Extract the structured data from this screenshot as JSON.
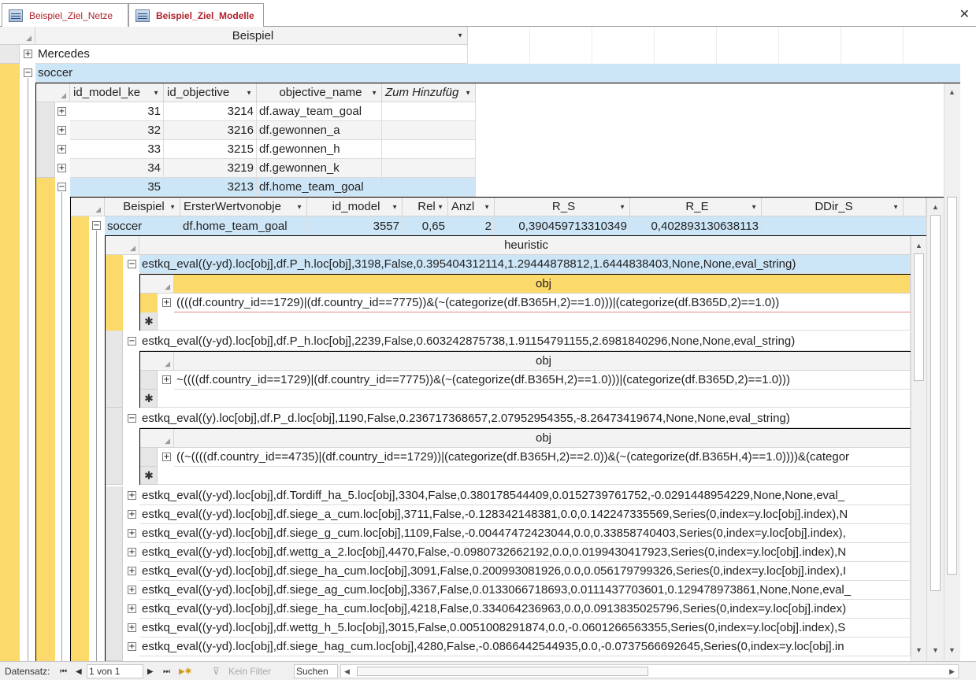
{
  "tabs": [
    {
      "label": "Beispiel_Ziel_Netze",
      "active": false
    },
    {
      "label": "Beispiel_Ziel_Modelle",
      "active": true
    }
  ],
  "close_glyph": "✕",
  "main_grid": {
    "header": "Beispiel",
    "rows": [
      "Mercedes",
      "soccer"
    ]
  },
  "sub1": {
    "headers": [
      "id_model_ke",
      "id_objective",
      "objective_name",
      "Zum Hinzufüg"
    ],
    "rows": [
      {
        "id_model": "31",
        "id_objective": "3214",
        "objective_name": "df.away_team_goal"
      },
      {
        "id_model": "32",
        "id_objective": "3216",
        "objective_name": "df.gewonnen_a"
      },
      {
        "id_model": "33",
        "id_objective": "3215",
        "objective_name": "df.gewonnen_h"
      },
      {
        "id_model": "34",
        "id_objective": "3219",
        "objective_name": "df.gewonnen_k"
      },
      {
        "id_model": "35",
        "id_objective": "3213",
        "objective_name": "df.home_team_goal"
      }
    ]
  },
  "sub2": {
    "headers": [
      "Beispiel",
      "ErsterWertvonobje",
      "id_model",
      "Rel",
      "Anzl",
      "R_S",
      "R_E",
      "DDir_S"
    ],
    "row": {
      "beispiel": "soccer",
      "erster": "df.home_team_goal",
      "id_model": "3557",
      "rel": "0,65",
      "anzl": "2",
      "r_s": "0,390459713310349",
      "r_e": "0,402893130638113"
    }
  },
  "sub3": {
    "header": "heuristic",
    "obj_header": "obj",
    "new_row_glyph": "✱",
    "expanded": [
      {
        "heuristic": "estkq_eval((y-yd).loc[obj],df.P_h.loc[obj],3198,False,0.395404312114,1.29444878812,1.6444838403,None,None,eval_string)",
        "obj": "((((df.country_id==1729)|(df.country_id==7775))&(~(categorize(df.B365H,2)==1.0)))|(categorize(df.B365D,2)==1.0))"
      },
      {
        "heuristic": "estkq_eval((y-yd).loc[obj],df.P_h.loc[obj],2239,False,0.603242875738,1.91154791155,2.6981840296,None,None,eval_string)",
        "obj": "~((((df.country_id==1729)|(df.country_id==7775))&(~(categorize(df.B365H,2)==1.0)))|(categorize(df.B365D,2)==1.0)))"
      },
      {
        "heuristic": "estkq_eval((y).loc[obj],df.P_d.loc[obj],1190,False,0.236717368657,2.07952954355,-8.26473419674,None,None,eval_string)",
        "obj": "((~((((df.country_id==4735)|(df.country_id==1729))|(categorize(df.B365H,2)==2.0))&(~(categorize(df.B365H,4)==1.0))))&(categor"
      }
    ],
    "collapsed": [
      "estkq_eval((y-yd).loc[obj],df.Tordiff_ha_5.loc[obj],3304,False,0.380178544409,0.0152739761752,-0.0291448954229,None,None,eval_",
      "estkq_eval((y-yd).loc[obj],df.siege_a_cum.loc[obj],3711,False,-0.128342148381,0.0,0.142247335569,Series(0,index=y.loc[obj].index),N",
      "estkq_eval((y-yd).loc[obj],df.siege_g_cum.loc[obj],1109,False,-0.00447472423044,0.0,0.33858740403,Series(0,index=y.loc[obj].index),",
      "estkq_eval((y-yd).loc[obj],df.wettg_a_2.loc[obj],4470,False,-0.0980732662192,0.0,0.0199430417923,Series(0,index=y.loc[obj].index),N",
      "estkq_eval((y-yd).loc[obj],df.siege_ha_cum.loc[obj],3091,False,0.200993081926,0.0,0.056179799326,Series(0,index=y.loc[obj].index),I",
      "estkq_eval((y-yd).loc[obj],df.siege_ag_cum.loc[obj],3367,False,0.0133066718693,0.0111437703601,0.129478973861,None,None,eval_",
      "estkq_eval((y-yd).loc[obj],df.siege_ha_cum.loc[obj],4218,False,0.334064236963,0.0,0.0913835025796,Series(0,index=y.loc[obj].index)",
      "estkq_eval((y-yd).loc[obj],df.wettg_h_5.loc[obj],3015,False,0.0051008291874,0.0,-0.0601266563355,Series(0,index=y.loc[obj].index),S",
      "estkq_eval((y-yd).loc[obj],df.siege_hag_cum.loc[obj],4280,False,-0.0866442544935,0.0,-0.0737566692645,Series(0,index=y.loc[obj].in"
    ]
  },
  "statusbar": {
    "label": "Datensatz:",
    "record": "1 von 1",
    "filter": "Kein Filter",
    "search": "Suchen"
  }
}
